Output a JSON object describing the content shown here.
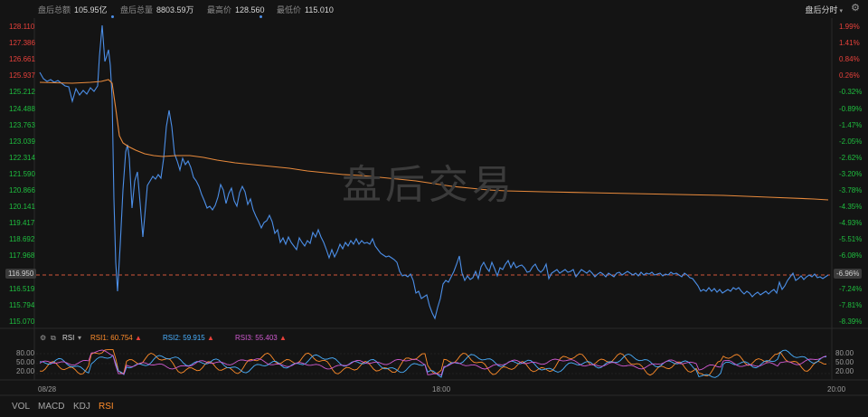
{
  "header": {
    "stats": [
      {
        "label": "盘后总额",
        "value": "105.95亿"
      },
      {
        "label": "盘后总量",
        "value": "8803.59万"
      },
      {
        "label": "最高价",
        "value": "128.560"
      },
      {
        "label": "最低价",
        "value": "115.010"
      }
    ],
    "mode_label": "盘后分时",
    "settings_icon": "gear-icon"
  },
  "main_chart": {
    "watermark": "盘后交易",
    "price_ticks": [
      "128.110",
      "127.386",
      "126.661",
      "125.937",
      "125.212",
      "124.488",
      "123.763",
      "123.039",
      "122.314",
      "121.590",
      "120.866",
      "120.141",
      "119.417",
      "118.692",
      "117.968",
      "117.243",
      "116.519",
      "115.794",
      "115.070"
    ],
    "pct_ticks": [
      "1.99%",
      "1.41%",
      "0.84%",
      "0.26%",
      "-0.32%",
      "-0.89%",
      "-1.47%",
      "-2.05%",
      "-2.62%",
      "-3.20%",
      "-3.78%",
      "-4.35%",
      "-4.93%",
      "-5.51%",
      "-6.08%",
      "-6.66%",
      "-7.24%",
      "-7.81%",
      "-8.39%"
    ],
    "current_price": "116.950",
    "current_pct": "-6.96%",
    "colors": {
      "price_line": "#4c8fe8",
      "avg_line": "#e88a3c",
      "up": "#e8413b",
      "down": "#1fbf3f",
      "ref_line": "#d0563a"
    }
  },
  "rsi": {
    "title": "RSI",
    "series": [
      {
        "label": "RSI1:",
        "value": "60.754",
        "color": "#ff8c2a"
      },
      {
        "label": "RSI2:",
        "value": "59.915",
        "color": "#4ab0ff"
      },
      {
        "label": "RSI3:",
        "value": "55.403",
        "color": "#d05ad0"
      }
    ],
    "axis_ticks": [
      "80.00",
      "50.00",
      "20.00"
    ]
  },
  "x_axis": {
    "ticks": [
      "08/28",
      "18:00",
      "20:00"
    ]
  },
  "bottom_tabs": [
    {
      "label": "VOL",
      "active": false
    },
    {
      "label": "MACD",
      "active": false
    },
    {
      "label": "KDJ",
      "active": false
    },
    {
      "label": "RSI",
      "active": true
    }
  ]
}
